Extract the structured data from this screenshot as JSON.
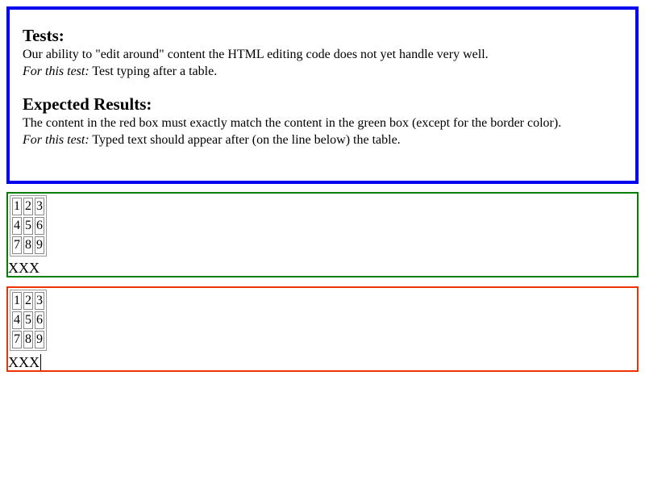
{
  "explanation": {
    "tests_heading": "Tests:",
    "tests_line": "Our ability to \"edit around\" content the HTML editing code does not yet handle very well.",
    "test_label": "For this test:",
    "test_text": " Test typing after a table.",
    "expected_heading": "Expected Results:",
    "expected_line": "The content in the red box must exactly match the content in the green box (except for the border color).",
    "expected_label": "For this test:",
    "expected_text": " Typed text should appear after (on the line below) the table."
  },
  "colors": {
    "explanation_border": "#0000ee",
    "expected_border": "#008000",
    "actual_border": "#ee3300"
  },
  "expected_box": {
    "table_rows": [
      [
        "1",
        "2",
        "3"
      ],
      [
        "4",
        "5",
        "6"
      ],
      [
        "7",
        "8",
        "9"
      ]
    ],
    "typed_text": "XXX"
  },
  "actual_box": {
    "table_rows": [
      [
        "1",
        "2",
        "3"
      ],
      [
        "4",
        "5",
        "6"
      ],
      [
        "7",
        "8",
        "9"
      ]
    ],
    "typed_text": "XXX"
  }
}
